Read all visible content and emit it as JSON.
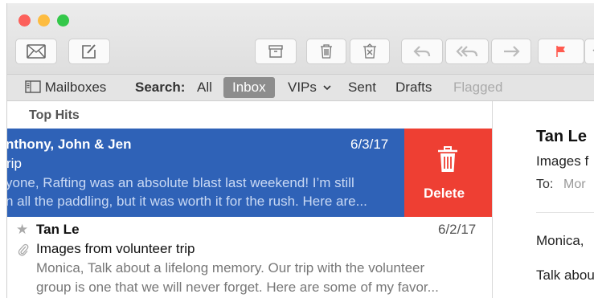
{
  "toolbar": {
    "window_controls": [
      "close",
      "minimize",
      "zoom"
    ],
    "buttons": [
      "get-mail",
      "compose",
      "archive",
      "delete",
      "junk",
      "reply",
      "reply-all",
      "forward",
      "flag",
      "flag-menu"
    ],
    "flag_color": "#ff5a4f"
  },
  "favorites": {
    "mailboxes": "Mailboxes",
    "search_label": "Search:",
    "all": "All",
    "inbox": "Inbox",
    "vips": "VIPs",
    "sent": "Sent",
    "drafts": "Drafts",
    "flagged": "Flagged"
  },
  "list": {
    "section_title": "Top Hits",
    "selected_message": {
      "sender": "nthony, John & Jen",
      "date": "6/3/17",
      "subject": "rip",
      "preview_line1": "yone, Rafting was an absolute blast last weekend! I’m still",
      "preview_line2": "n all the paddling, but it was worth it for the rush. Here are..."
    },
    "delete_action": {
      "label": "Delete",
      "color": "#ee3f33"
    },
    "message2": {
      "sender": "Tan Le",
      "date": "6/2/17",
      "subject": "Images from volunteer trip",
      "preview_line1": "Monica, Talk about a lifelong memory. Our trip with the volunteer",
      "preview_line2": "group is one that we will never forget. Here are some of my favor..."
    }
  },
  "detail": {
    "sender": "Tan Le",
    "subject": "Images f",
    "to_label": "To:",
    "to_value": "Mor",
    "body_line1": "Monica,",
    "body_line2": "Talk abou"
  },
  "colors": {
    "selection": "#2f62b7",
    "close": "#fc605b",
    "minimize": "#fdbc40",
    "zoom": "#34c84a"
  }
}
